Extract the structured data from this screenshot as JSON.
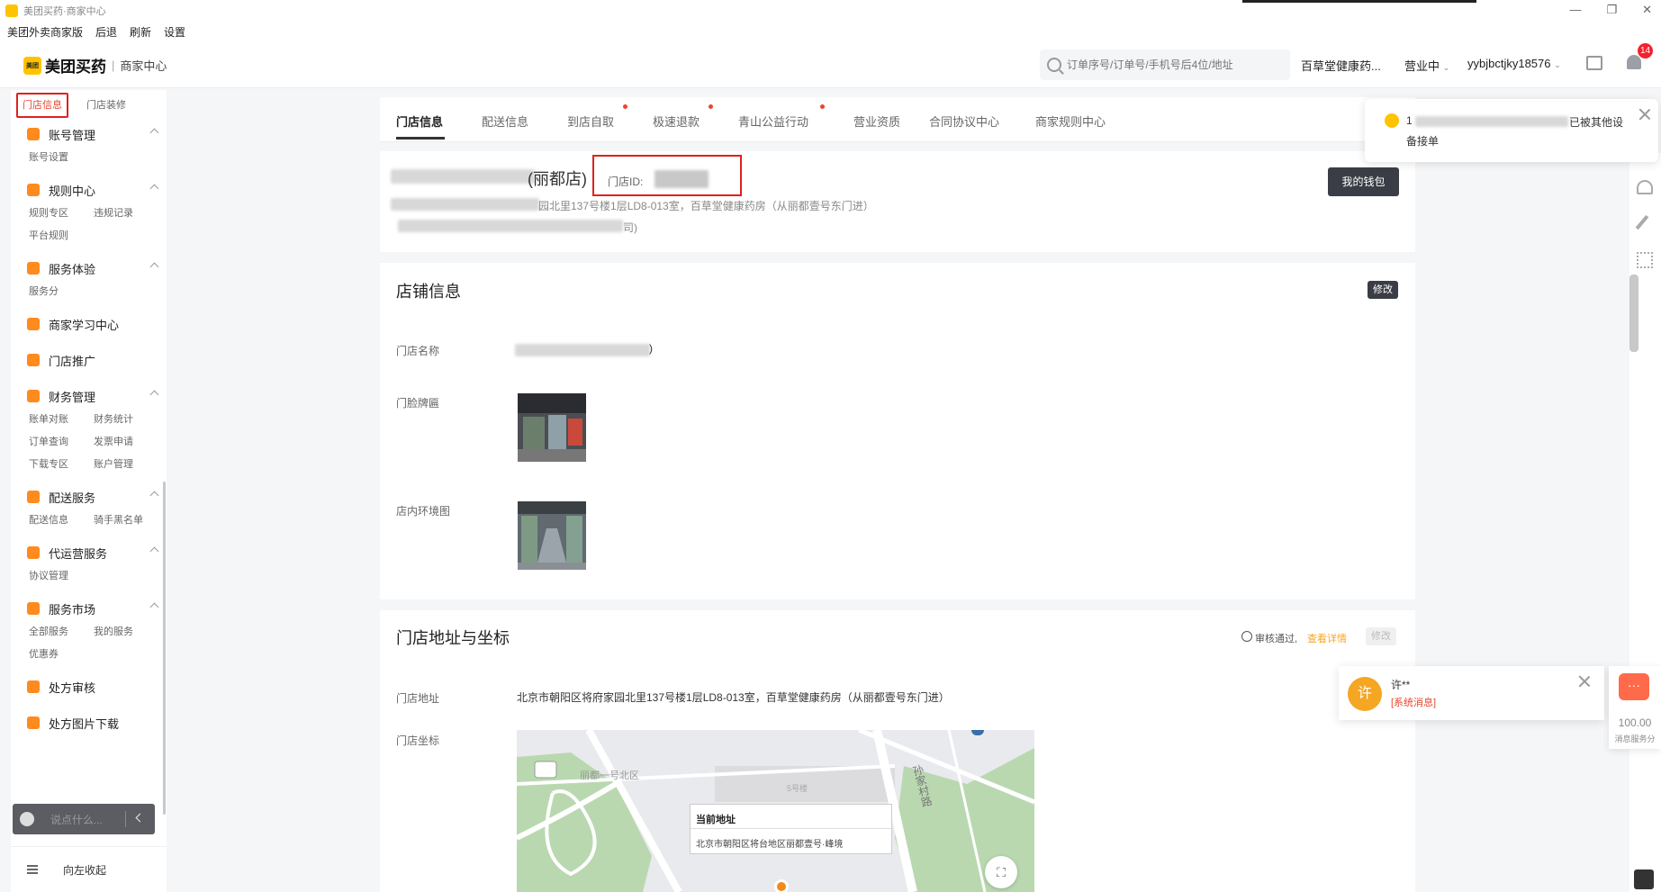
{
  "window": {
    "title": "美团买药·商家中心"
  },
  "menubar": {
    "items": [
      "美团外卖商家版",
      "后退",
      "刷新",
      "设置"
    ]
  },
  "header": {
    "brand_name": "美团买药",
    "brand_icon_text": "美团",
    "brand_sub": "商家中心",
    "search_placeholder": "订单序号/订单号/手机号后4位/地址",
    "store_select": "百草堂健康药...",
    "status_select": "营业中",
    "account_select": "yybjbctjky18576",
    "notification_count": "14"
  },
  "sidebar": {
    "top_tabs": [
      "门店信息",
      "门店装修"
    ],
    "groups": [
      {
        "label": "账号管理",
        "icon_color": "#ff8a1e",
        "subs": [
          "账号设置"
        ]
      },
      {
        "label": "规则中心",
        "icon_color": "#ff8a1e",
        "subs": [
          "规则专区",
          "违规记录",
          "平台规则"
        ]
      },
      {
        "label": "服务体验",
        "icon_color": "#ff8a1e",
        "subs": [
          "服务分"
        ]
      },
      {
        "label": "商家学习中心",
        "icon_color": "#ff8a1e",
        "subs": []
      },
      {
        "label": "门店推广",
        "icon_color": "#ff8a1e",
        "subs": []
      },
      {
        "label": "财务管理",
        "icon_color": "#ff8a1e",
        "subs": [
          "账单对账",
          "财务统计",
          "订单查询",
          "发票申请",
          "下载专区",
          "账户管理"
        ]
      },
      {
        "label": "配送服务",
        "icon_color": "#ff8a1e",
        "subs": [
          "配送信息",
          "骑手黑名单"
        ]
      },
      {
        "label": "代运营服务",
        "icon_color": "#ff8a1e",
        "subs": [
          "协议管理"
        ]
      },
      {
        "label": "服务市场",
        "icon_color": "#ff8a1e",
        "subs": [
          "全部服务",
          "我的服务",
          "优惠券"
        ]
      },
      {
        "label": "处方审核",
        "icon_color": "#ff8a1e",
        "subs": []
      },
      {
        "label": "处方图片下载",
        "icon_color": "#ff8a1e",
        "subs": []
      }
    ],
    "chat_placeholder": "说点什么...",
    "collapse_label": "向左收起"
  },
  "tabs": [
    "门店信息",
    "配送信息",
    "到店自取",
    "极速退款",
    "青山公益行动",
    "营业资质",
    "合同协议中心",
    "商家规则中心"
  ],
  "store_header": {
    "name_suffix": "(丽都店)",
    "store_id_label": "门店ID:",
    "address_partial": "园北里137号楼1层LD8-013室，百草堂健康药房（从丽都壹号东门进）",
    "line3_end": "司)",
    "wallet_button": "我的钱包"
  },
  "store_info": {
    "title": "店铺信息",
    "edit_button": "修改",
    "name_label": "门店名称",
    "name_value_end": ")",
    "facade_label": "门脸牌匾",
    "interior_label": "店内环境图"
  },
  "address_section": {
    "title": "门店地址与坐标",
    "audit_status": "审核通过,",
    "audit_link": "查看详情",
    "edit_button": "修改",
    "address_label": "门店地址",
    "address_value": "北京市朝阳区将府家园北里137号楼1层LD8-013室，百草堂健康药房（从丽都壹号东门进）",
    "coord_label": "门店坐标",
    "map": {
      "district_label": "丽都一号北区",
      "building_label": "5号楼",
      "road_label": "孙家村路",
      "popup_title": "当前地址",
      "popup_address": "北京市朝阳区将台地区丽都壹号·峰境"
    }
  },
  "notification": {
    "text_start": "1",
    "text_end": "已被其他设",
    "line2": "备接单"
  },
  "message_card": {
    "avatar_char": "许",
    "name": "许**",
    "tag": "[系统消息]"
  },
  "service_widget": {
    "score": "100.00",
    "label": "消息服务分"
  },
  "colors": {
    "accent": "#ffc300",
    "alert_red": "#e02020",
    "dark_button": "#3a3d45",
    "link_orange": "#f5a623"
  }
}
